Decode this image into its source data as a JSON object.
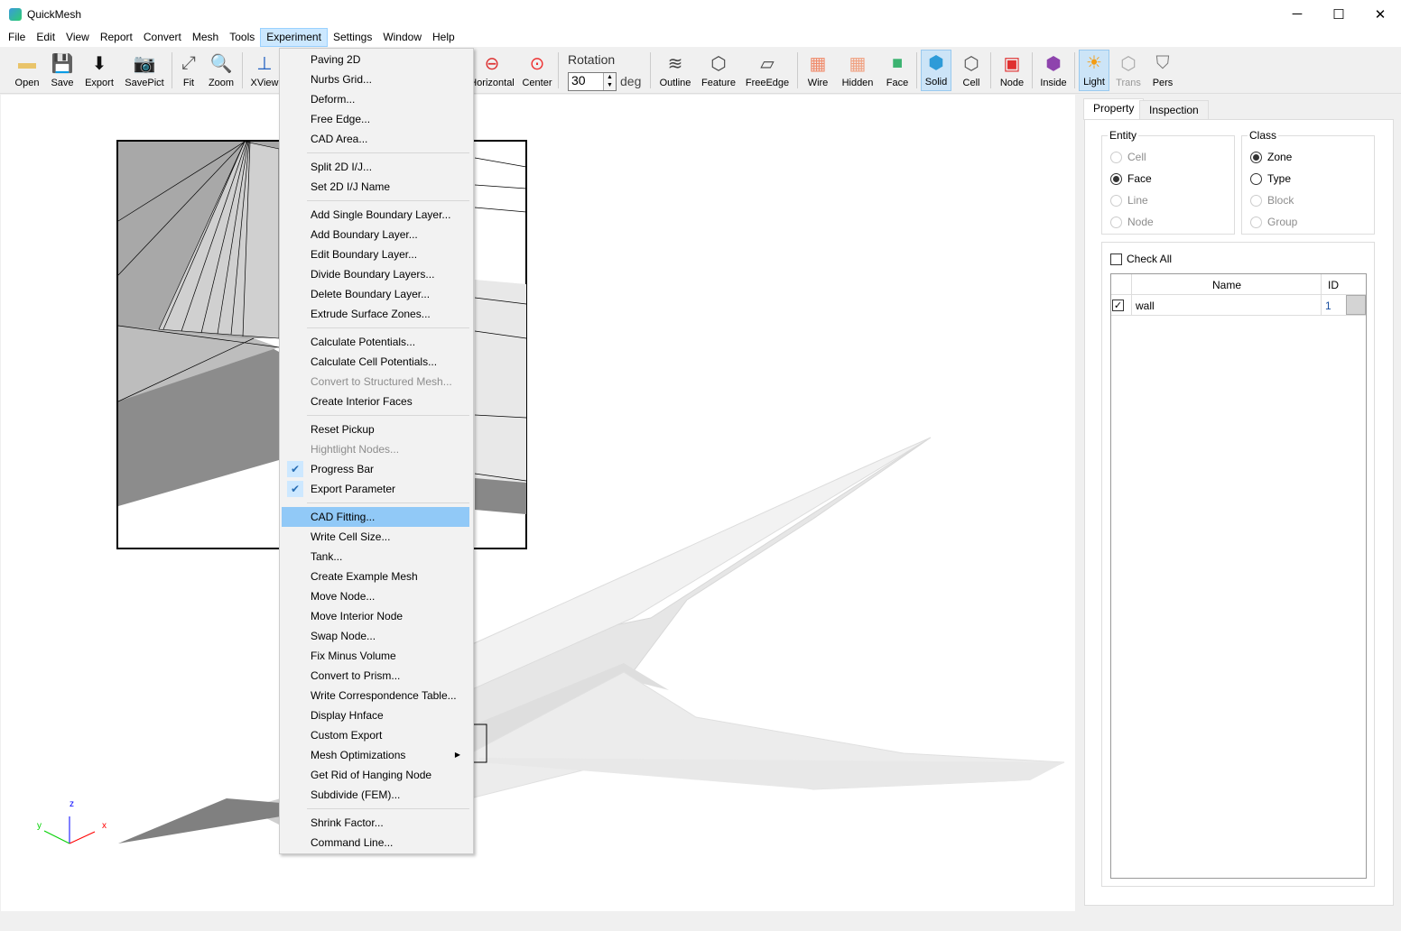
{
  "window": {
    "title": "QuickMesh",
    "minimize": "─",
    "maximize": "☐",
    "close": "✕"
  },
  "menubar": [
    "File",
    "Edit",
    "View",
    "Report",
    "Convert",
    "Mesh",
    "Tools",
    "Experiment",
    "Settings",
    "Window",
    "Help"
  ],
  "toolbar": {
    "left": [
      {
        "label": "Open",
        "icon": "folder-icon"
      },
      {
        "label": "Save",
        "icon": "floppy-icon"
      },
      {
        "label": "Export",
        "icon": "download-icon"
      },
      {
        "label": "SavePict",
        "icon": "camera-icon"
      },
      {
        "label": "Fit",
        "icon": "fit-icon"
      },
      {
        "label": "Zoom",
        "icon": "zoom-icon"
      },
      {
        "label": "XView",
        "icon": "axis-icon"
      }
    ],
    "mid": [
      {
        "label": "Horizontal",
        "icon": "horizontal-rotate-icon"
      },
      {
        "label": "Center",
        "icon": "center-icon"
      }
    ],
    "rotation": {
      "label": "Rotation",
      "value": "30",
      "unit": "deg"
    },
    "right": [
      {
        "label": "Outline",
        "icon": "outline-icon"
      },
      {
        "label": "Feature",
        "icon": "feature-icon"
      },
      {
        "label": "FreeEdge",
        "icon": "free-edge-icon"
      },
      {
        "label": "Wire",
        "icon": "wire-icon"
      },
      {
        "label": "Hidden",
        "icon": "hidden-icon"
      },
      {
        "label": "Face",
        "icon": "face-icon"
      },
      {
        "label": "Solid",
        "icon": "solid-icon",
        "active": true
      },
      {
        "label": "Cell",
        "icon": "cell-icon"
      },
      {
        "label": "Node",
        "icon": "node-icon"
      },
      {
        "label": "Inside",
        "icon": "inside-icon"
      },
      {
        "label": "Light",
        "icon": "light-icon",
        "active": true
      },
      {
        "label": "Trans",
        "icon": "trans-icon",
        "disabled": true
      },
      {
        "label": "Pers",
        "icon": "pers-icon"
      }
    ]
  },
  "experiment_menu": [
    {
      "label": "Paving 2D"
    },
    {
      "label": "Nurbs Grid..."
    },
    {
      "label": "Deform..."
    },
    {
      "label": "Free Edge..."
    },
    {
      "label": "CAD Area..."
    },
    {
      "sep": true
    },
    {
      "label": "Split 2D I/J..."
    },
    {
      "label": "Set 2D I/J Name"
    },
    {
      "sep": true
    },
    {
      "label": "Add Single Boundary Layer..."
    },
    {
      "label": "Add Boundary Layer..."
    },
    {
      "label": "Edit Boundary Layer..."
    },
    {
      "label": "Divide Boundary Layers..."
    },
    {
      "label": "Delete Boundary Layer..."
    },
    {
      "label": "Extrude Surface Zones..."
    },
    {
      "sep": true
    },
    {
      "label": "Calculate Potentials..."
    },
    {
      "label": "Calculate Cell Potentials..."
    },
    {
      "label": "Convert to Structured Mesh...",
      "disabled": true
    },
    {
      "label": "Create Interior Faces"
    },
    {
      "sep": true
    },
    {
      "label": "Reset Pickup"
    },
    {
      "label": "Hightlight Nodes...",
      "disabled": true
    },
    {
      "label": "Progress Bar",
      "checked": true
    },
    {
      "label": "Export Parameter",
      "checked": true
    },
    {
      "sep": true
    },
    {
      "label": "CAD Fitting...",
      "highlighted": true
    },
    {
      "label": "Write Cell Size..."
    },
    {
      "label": "Tank..."
    },
    {
      "label": "Create Example Mesh"
    },
    {
      "label": "Move Node..."
    },
    {
      "label": "Move Interior Node"
    },
    {
      "label": "Swap Node..."
    },
    {
      "label": "Fix Minus Volume"
    },
    {
      "label": "Convert to Prism..."
    },
    {
      "label": "Write Correspondence Table..."
    },
    {
      "label": "Display Hnface"
    },
    {
      "label": "Custom Export"
    },
    {
      "label": "Mesh Optimizations",
      "submenu": true
    },
    {
      "label": "Get Rid of Hanging Node"
    },
    {
      "label": "Subdivide (FEM)..."
    },
    {
      "sep": true
    },
    {
      "label": "Shrink Factor..."
    },
    {
      "label": "Command Line..."
    }
  ],
  "axes": {
    "x": "x",
    "y": "y",
    "z": "z"
  },
  "panel": {
    "tabs": [
      "Property",
      "Inspection"
    ],
    "entity": {
      "title": "Entity",
      "options": [
        {
          "label": "Cell",
          "disabled": true
        },
        {
          "label": "Face",
          "selected": true
        },
        {
          "label": "Line",
          "disabled": true
        },
        {
          "label": "Node",
          "disabled": true
        }
      ]
    },
    "class": {
      "title": "Class",
      "options": [
        {
          "label": "Zone",
          "selected": true
        },
        {
          "label": "Type"
        },
        {
          "label": "Block",
          "disabled": true
        },
        {
          "label": "Group",
          "disabled": true
        }
      ]
    },
    "check_all": "Check All",
    "table": {
      "headers": [
        "Name",
        "ID"
      ],
      "rows": [
        {
          "checked": true,
          "name": "wall",
          "id": "1"
        }
      ]
    }
  }
}
